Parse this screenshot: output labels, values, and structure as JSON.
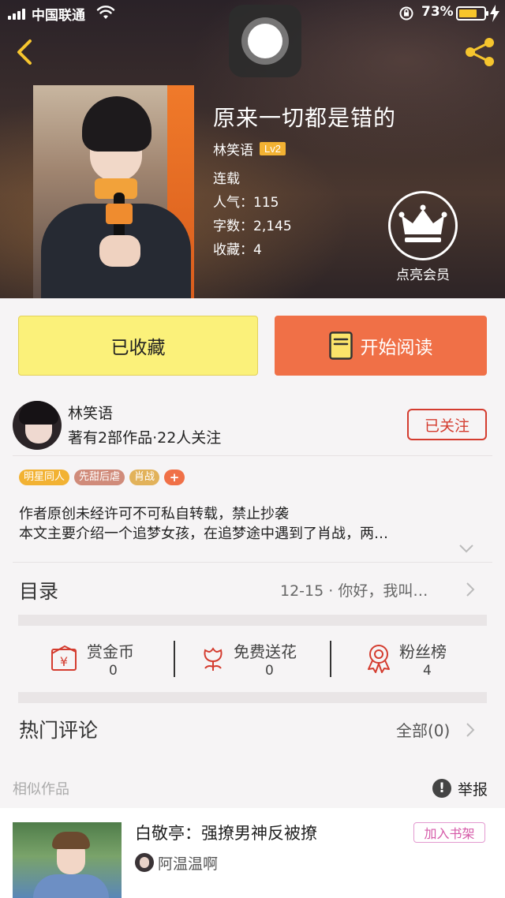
{
  "status_bar": {
    "carrier": "中国联通",
    "battery_percent": "73%"
  },
  "book": {
    "title": "原来一切都是错的",
    "author": "林笑语",
    "author_level": "Lv2",
    "status": "连载",
    "popularity": "人气：115",
    "word_count": "字数：2,145",
    "favorites": "收藏：4"
  },
  "vip_label": "点亮会员",
  "actions": {
    "collect_label": "已收藏",
    "read_label": "开始阅读"
  },
  "author_card": {
    "name": "林笑语",
    "stats": "著有2部作品·22人关注",
    "follow_label": "已关注"
  },
  "tags": [
    {
      "label": "明星同人",
      "color": "#f2b233"
    },
    {
      "label": "先甜后虐",
      "color": "#d08b7a"
    },
    {
      "label": "肖战",
      "color": "#e2b25a"
    },
    {
      "label": "+",
      "color": "#f07047"
    }
  ],
  "description": {
    "line1": "作者原创未经许可不可私自转载，禁止抄袭",
    "line2": "本文主要介绍一个追梦女孩，在追梦途中遇到了肖战，两…"
  },
  "toc": {
    "label": "目录",
    "latest": "12-15 · 你好，我叫…"
  },
  "stats": [
    {
      "label": "赏金币",
      "value": "0",
      "icon": "coin-envelope-icon"
    },
    {
      "label": "免费送花",
      "value": "0",
      "icon": "flower-icon"
    },
    {
      "label": "粉丝榜",
      "value": "4",
      "icon": "medal-icon"
    }
  ],
  "comments": {
    "label": "热门评论",
    "all_label": "全部(0)"
  },
  "similar": {
    "section_label": "相似作品",
    "report_label": "举报",
    "item": {
      "title": "白敬亭：强撩男神反被撩",
      "author": "阿温温啊",
      "add_label": "加入书架"
    }
  },
  "colors": {
    "accent_orange": "#f07047",
    "collect_yellow": "#fbf17a",
    "follow_red": "#d43c2f",
    "tag_yellow": "#f2b233"
  }
}
